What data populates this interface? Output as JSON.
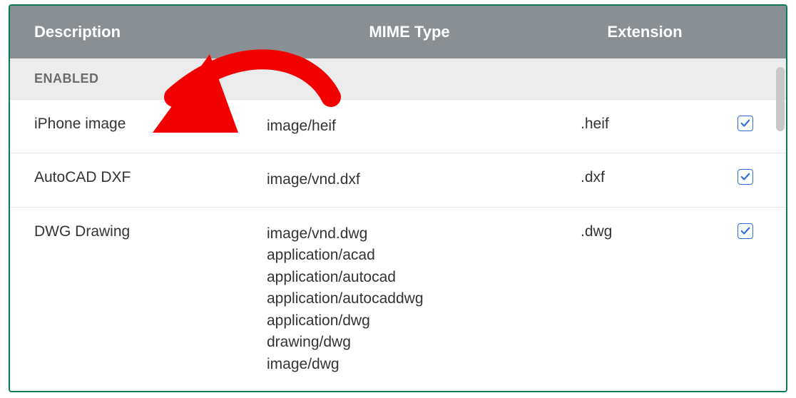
{
  "headers": {
    "description": "Description",
    "mime": "MIME Type",
    "extension": "Extension"
  },
  "group_label": "ENABLED",
  "rows": [
    {
      "description": "iPhone image",
      "mimes": [
        "image/heif"
      ],
      "extension": ".heif",
      "enabled": true
    },
    {
      "description": "AutoCAD DXF",
      "mimes": [
        "image/vnd.dxf"
      ],
      "extension": ".dxf",
      "enabled": true
    },
    {
      "description": "DWG Drawing",
      "mimes": [
        "image/vnd.dwg",
        "application/acad",
        "application/autocad",
        "application/autocaddwg",
        "application/dwg",
        "drawing/dwg",
        "image/dwg"
      ],
      "extension": ".dwg",
      "enabled": true
    }
  ]
}
